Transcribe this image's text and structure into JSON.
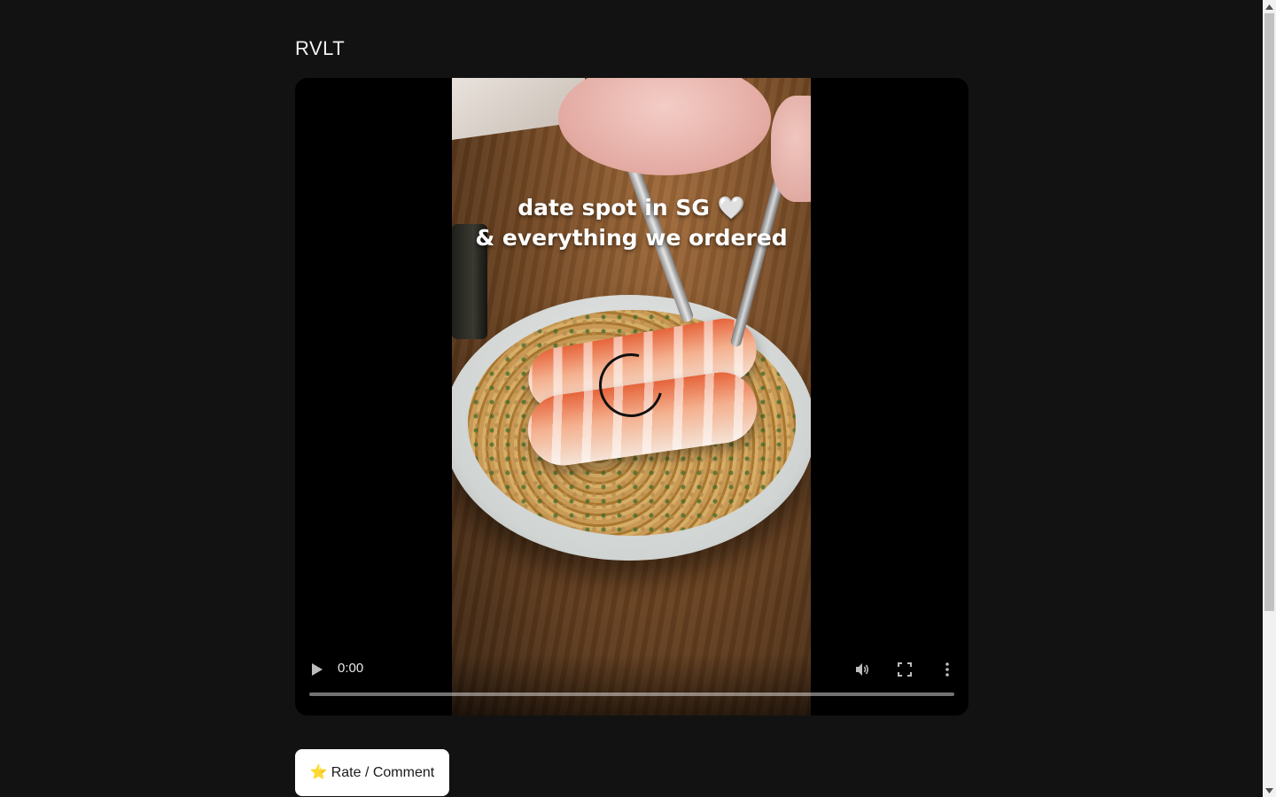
{
  "site": {
    "title": "RVLT"
  },
  "video": {
    "caption_line1": "date spot in SG 🤍",
    "caption_line2": "& everything we ordered",
    "current_time": "0:00",
    "progress": 0,
    "icons": {
      "play": "play-icon",
      "volume": "volume-icon",
      "fullscreen": "fullscreen-icon",
      "more": "more-vertical-icon",
      "loading": "loading-spinner-icon"
    }
  },
  "actions": {
    "rate_icon": "⭐",
    "rate_label": "Rate / Comment"
  },
  "colors": {
    "page_background": "#121212",
    "title_text": "#f2f2f2",
    "button_background": "#ffffff",
    "star": "#f5b400"
  }
}
